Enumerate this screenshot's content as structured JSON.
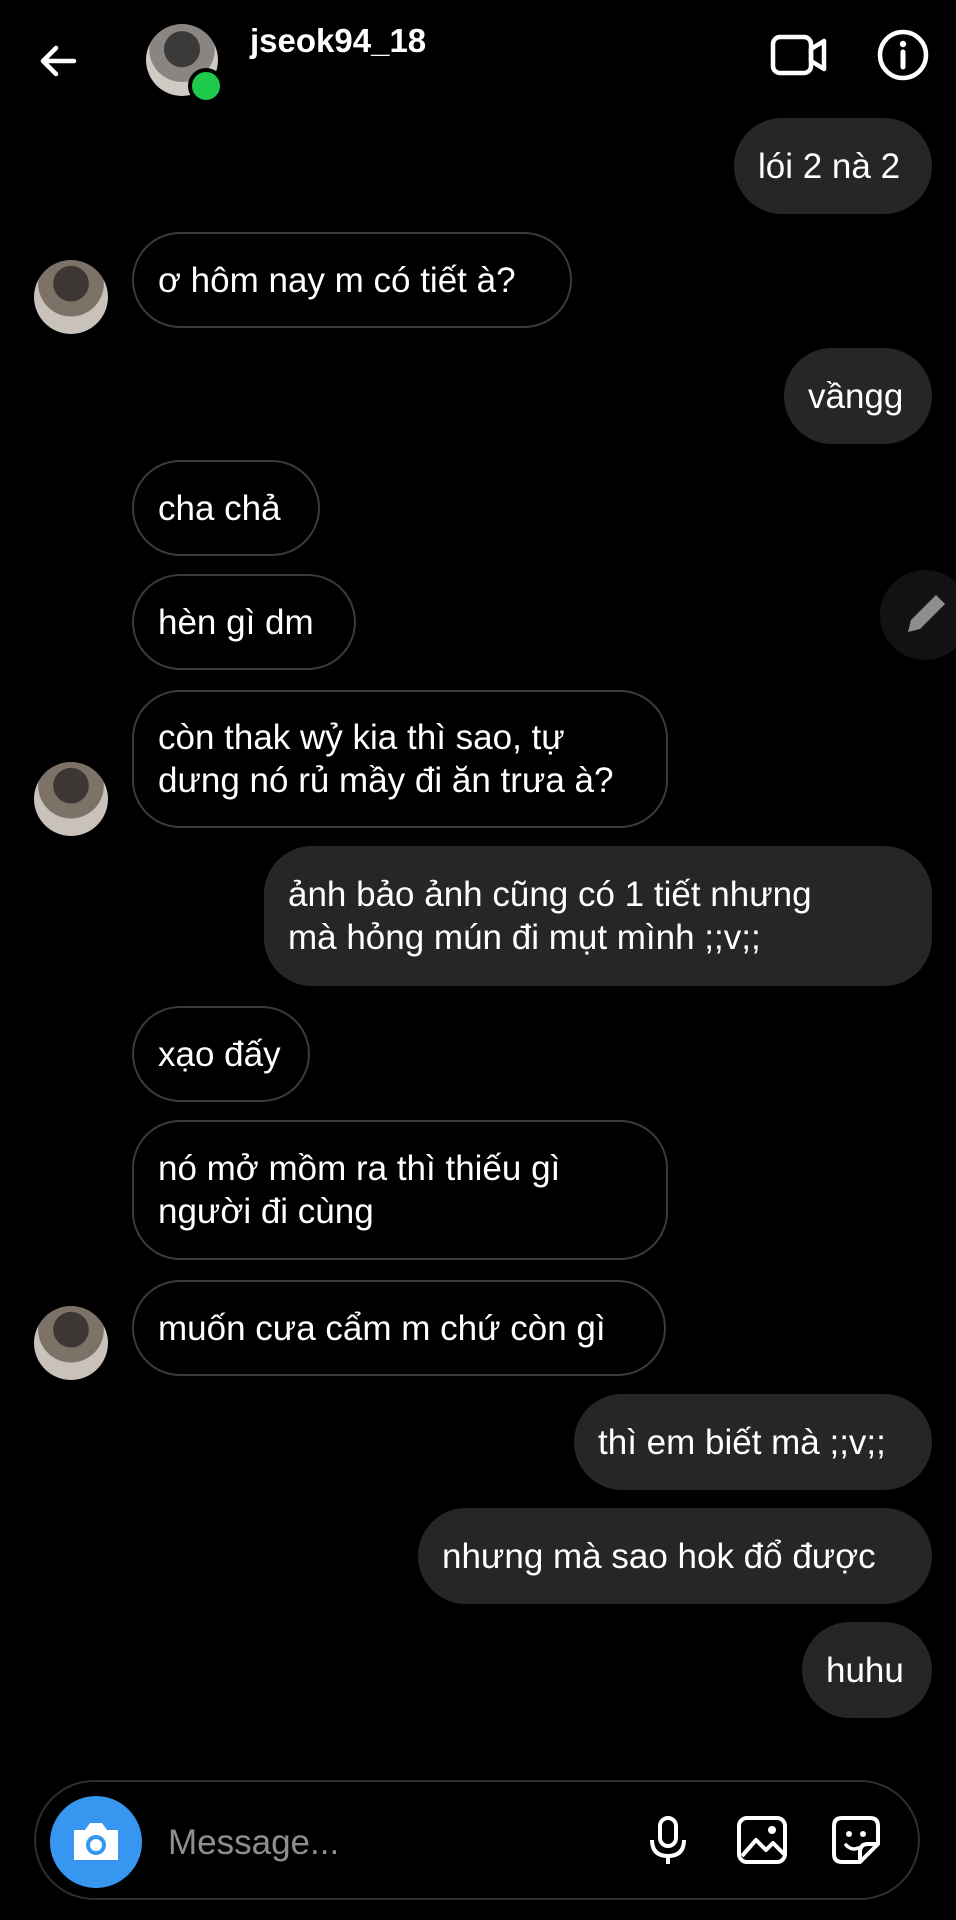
{
  "header": {
    "username": "jseok94_18"
  },
  "messages": [
    {
      "side": "out",
      "text": "lói 2 nà 2"
    },
    {
      "side": "in",
      "text": "ơ hôm nay m có tiết à?"
    },
    {
      "side": "out",
      "text": "vầngg"
    },
    {
      "side": "in",
      "text": "cha chả"
    },
    {
      "side": "in",
      "text": "hèn gì dm"
    },
    {
      "side": "in",
      "text": "còn thak wỷ kia thì sao, tự\ndưng nó rủ mầy đi ăn trưa à?"
    },
    {
      "side": "out",
      "text": "ảnh bảo ảnh cũng có 1 tiết nhưng\nmà hỏng mún đi mụt mình ;;v;;"
    },
    {
      "side": "in",
      "text": "xạo đấy"
    },
    {
      "side": "in",
      "text": "nó mở mồm ra thì thiếu gì\nngười đi cùng"
    },
    {
      "side": "in",
      "text": "muốn cưa cẩm m chứ còn gì"
    },
    {
      "side": "out",
      "text": "thì em biết mà ;;v;;"
    },
    {
      "side": "out",
      "text": "nhưng mà sao hok đổ được"
    },
    {
      "side": "out",
      "text": "huhu"
    }
  ],
  "composer": {
    "placeholder": "Message..."
  },
  "colors": {
    "background": "#000000",
    "outgoing_bubble": "#262626",
    "incoming_border": "#3a3a3a",
    "camera_button": "#3797f0",
    "online_status": "#1ec94c"
  },
  "icons": [
    "back-arrow-icon",
    "video-call-icon",
    "info-icon",
    "edit-pencil-icon",
    "camera-icon",
    "microphone-icon",
    "gallery-icon",
    "sticker-icon"
  ]
}
